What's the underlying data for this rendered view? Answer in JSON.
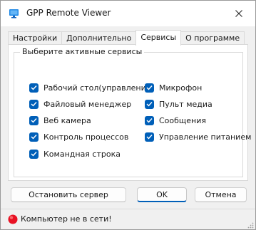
{
  "window": {
    "title": "GPP Remote Viewer"
  },
  "tabs": [
    {
      "label": "Настройки",
      "active": false
    },
    {
      "label": "Дополнительно",
      "active": false
    },
    {
      "label": "Сервисы",
      "active": true
    },
    {
      "label": "О программе",
      "active": false
    }
  ],
  "services": {
    "group_title": "Выберите активные сервисы",
    "left": [
      {
        "label": "Рабочий стол(управление)",
        "checked": true
      },
      {
        "label": "Файловый менеджер",
        "checked": true
      },
      {
        "label": "Веб камера",
        "checked": true
      },
      {
        "label": "Контроль процессов",
        "checked": true
      },
      {
        "label": "Командная строка",
        "checked": true
      }
    ],
    "right": [
      {
        "label": "Микрофон",
        "checked": true
      },
      {
        "label": "Пульт медиа",
        "checked": true
      },
      {
        "label": "Сообщения",
        "checked": true
      },
      {
        "label": "Управление питанием",
        "checked": true
      }
    ]
  },
  "buttons": {
    "stop_server": "Остановить сервер",
    "ok": "OK",
    "cancel": "Отмена"
  },
  "status": {
    "text": "Компьютер не в сети!",
    "icon": "red-status-dot-icon",
    "color": "#e81123"
  },
  "colors": {
    "accent": "#005fb8"
  }
}
